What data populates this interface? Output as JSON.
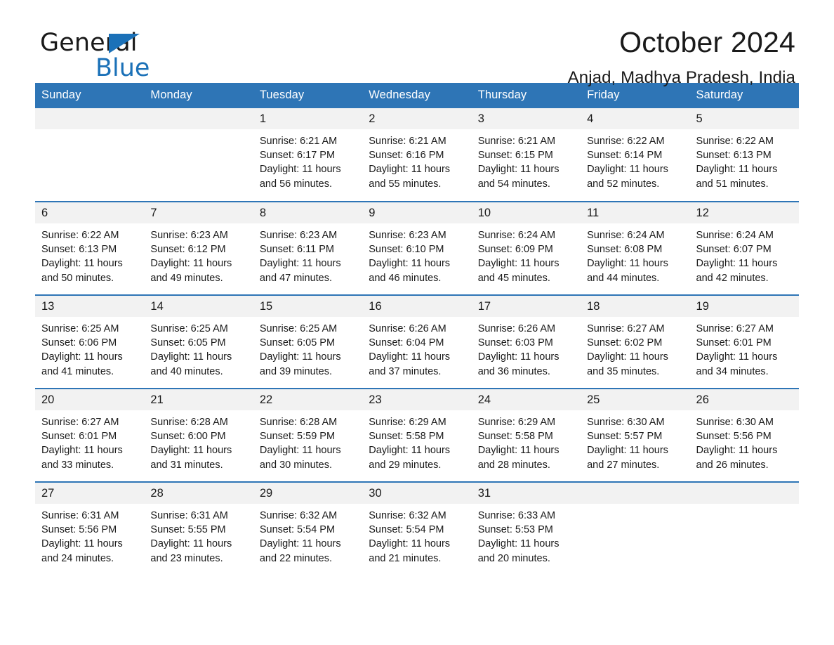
{
  "brand": {
    "line1": "General",
    "line2": "Blue",
    "triangle_icon": "brand-triangle-icon",
    "colors": {
      "text": "#1a1a1a",
      "accent": "#1b71b8"
    }
  },
  "header": {
    "month_title": "October 2024",
    "location": "Anjad, Madhya Pradesh, India"
  },
  "colors": {
    "header_blue": "#2e75b6",
    "daynum_band": "#f2f2f2",
    "cell_background": "#ffffff",
    "text": "#1a1a1a"
  },
  "weekday_headers": [
    "Sunday",
    "Monday",
    "Tuesday",
    "Wednesday",
    "Thursday",
    "Friday",
    "Saturday"
  ],
  "weeks": [
    [
      {
        "day": "",
        "sunrise": "",
        "sunset": "",
        "daylight": ""
      },
      {
        "day": "",
        "sunrise": "",
        "sunset": "",
        "daylight": ""
      },
      {
        "day": "1",
        "sunrise": "Sunrise: 6:21 AM",
        "sunset": "Sunset: 6:17 PM",
        "daylight": "Daylight: 11 hours and 56 minutes."
      },
      {
        "day": "2",
        "sunrise": "Sunrise: 6:21 AM",
        "sunset": "Sunset: 6:16 PM",
        "daylight": "Daylight: 11 hours and 55 minutes."
      },
      {
        "day": "3",
        "sunrise": "Sunrise: 6:21 AM",
        "sunset": "Sunset: 6:15 PM",
        "daylight": "Daylight: 11 hours and 54 minutes."
      },
      {
        "day": "4",
        "sunrise": "Sunrise: 6:22 AM",
        "sunset": "Sunset: 6:14 PM",
        "daylight": "Daylight: 11 hours and 52 minutes."
      },
      {
        "day": "5",
        "sunrise": "Sunrise: 6:22 AM",
        "sunset": "Sunset: 6:13 PM",
        "daylight": "Daylight: 11 hours and 51 minutes."
      }
    ],
    [
      {
        "day": "6",
        "sunrise": "Sunrise: 6:22 AM",
        "sunset": "Sunset: 6:13 PM",
        "daylight": "Daylight: 11 hours and 50 minutes."
      },
      {
        "day": "7",
        "sunrise": "Sunrise: 6:23 AM",
        "sunset": "Sunset: 6:12 PM",
        "daylight": "Daylight: 11 hours and 49 minutes."
      },
      {
        "day": "8",
        "sunrise": "Sunrise: 6:23 AM",
        "sunset": "Sunset: 6:11 PM",
        "daylight": "Daylight: 11 hours and 47 minutes."
      },
      {
        "day": "9",
        "sunrise": "Sunrise: 6:23 AM",
        "sunset": "Sunset: 6:10 PM",
        "daylight": "Daylight: 11 hours and 46 minutes."
      },
      {
        "day": "10",
        "sunrise": "Sunrise: 6:24 AM",
        "sunset": "Sunset: 6:09 PM",
        "daylight": "Daylight: 11 hours and 45 minutes."
      },
      {
        "day": "11",
        "sunrise": "Sunrise: 6:24 AM",
        "sunset": "Sunset: 6:08 PM",
        "daylight": "Daylight: 11 hours and 44 minutes."
      },
      {
        "day": "12",
        "sunrise": "Sunrise: 6:24 AM",
        "sunset": "Sunset: 6:07 PM",
        "daylight": "Daylight: 11 hours and 42 minutes."
      }
    ],
    [
      {
        "day": "13",
        "sunrise": "Sunrise: 6:25 AM",
        "sunset": "Sunset: 6:06 PM",
        "daylight": "Daylight: 11 hours and 41 minutes."
      },
      {
        "day": "14",
        "sunrise": "Sunrise: 6:25 AM",
        "sunset": "Sunset: 6:05 PM",
        "daylight": "Daylight: 11 hours and 40 minutes."
      },
      {
        "day": "15",
        "sunrise": "Sunrise: 6:25 AM",
        "sunset": "Sunset: 6:05 PM",
        "daylight": "Daylight: 11 hours and 39 minutes."
      },
      {
        "day": "16",
        "sunrise": "Sunrise: 6:26 AM",
        "sunset": "Sunset: 6:04 PM",
        "daylight": "Daylight: 11 hours and 37 minutes."
      },
      {
        "day": "17",
        "sunrise": "Sunrise: 6:26 AM",
        "sunset": "Sunset: 6:03 PM",
        "daylight": "Daylight: 11 hours and 36 minutes."
      },
      {
        "day": "18",
        "sunrise": "Sunrise: 6:27 AM",
        "sunset": "Sunset: 6:02 PM",
        "daylight": "Daylight: 11 hours and 35 minutes."
      },
      {
        "day": "19",
        "sunrise": "Sunrise: 6:27 AM",
        "sunset": "Sunset: 6:01 PM",
        "daylight": "Daylight: 11 hours and 34 minutes."
      }
    ],
    [
      {
        "day": "20",
        "sunrise": "Sunrise: 6:27 AM",
        "sunset": "Sunset: 6:01 PM",
        "daylight": "Daylight: 11 hours and 33 minutes."
      },
      {
        "day": "21",
        "sunrise": "Sunrise: 6:28 AM",
        "sunset": "Sunset: 6:00 PM",
        "daylight": "Daylight: 11 hours and 31 minutes."
      },
      {
        "day": "22",
        "sunrise": "Sunrise: 6:28 AM",
        "sunset": "Sunset: 5:59 PM",
        "daylight": "Daylight: 11 hours and 30 minutes."
      },
      {
        "day": "23",
        "sunrise": "Sunrise: 6:29 AM",
        "sunset": "Sunset: 5:58 PM",
        "daylight": "Daylight: 11 hours and 29 minutes."
      },
      {
        "day": "24",
        "sunrise": "Sunrise: 6:29 AM",
        "sunset": "Sunset: 5:58 PM",
        "daylight": "Daylight: 11 hours and 28 minutes."
      },
      {
        "day": "25",
        "sunrise": "Sunrise: 6:30 AM",
        "sunset": "Sunset: 5:57 PM",
        "daylight": "Daylight: 11 hours and 27 minutes."
      },
      {
        "day": "26",
        "sunrise": "Sunrise: 6:30 AM",
        "sunset": "Sunset: 5:56 PM",
        "daylight": "Daylight: 11 hours and 26 minutes."
      }
    ],
    [
      {
        "day": "27",
        "sunrise": "Sunrise: 6:31 AM",
        "sunset": "Sunset: 5:56 PM",
        "daylight": "Daylight: 11 hours and 24 minutes."
      },
      {
        "day": "28",
        "sunrise": "Sunrise: 6:31 AM",
        "sunset": "Sunset: 5:55 PM",
        "daylight": "Daylight: 11 hours and 23 minutes."
      },
      {
        "day": "29",
        "sunrise": "Sunrise: 6:32 AM",
        "sunset": "Sunset: 5:54 PM",
        "daylight": "Daylight: 11 hours and 22 minutes."
      },
      {
        "day": "30",
        "sunrise": "Sunrise: 6:32 AM",
        "sunset": "Sunset: 5:54 PM",
        "daylight": "Daylight: 11 hours and 21 minutes."
      },
      {
        "day": "31",
        "sunrise": "Sunrise: 6:33 AM",
        "sunset": "Sunset: 5:53 PM",
        "daylight": "Daylight: 11 hours and 20 minutes."
      },
      {
        "day": "",
        "sunrise": "",
        "sunset": "",
        "daylight": ""
      },
      {
        "day": "",
        "sunrise": "",
        "sunset": "",
        "daylight": ""
      }
    ]
  ]
}
